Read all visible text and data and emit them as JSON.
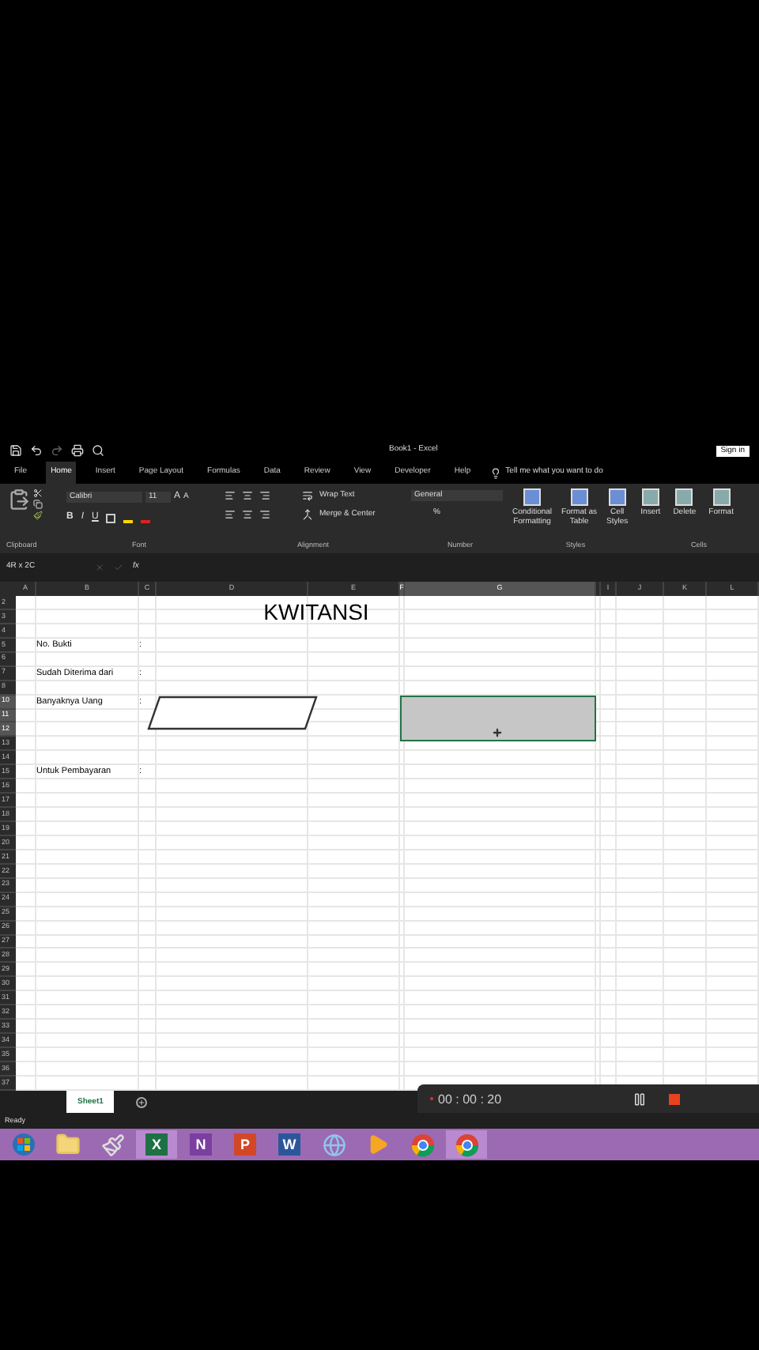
{
  "window": {
    "title": "Book1 - Excel",
    "sign_in": "Sign in"
  },
  "ribbon_tabs": [
    {
      "label": "File",
      "selected": false
    },
    {
      "label": "Home",
      "selected": true
    },
    {
      "label": "Insert",
      "selected": false
    },
    {
      "label": "Page Layout",
      "selected": false
    },
    {
      "label": "Formulas",
      "selected": false
    },
    {
      "label": "Data",
      "selected": false
    },
    {
      "label": "Review",
      "selected": false
    },
    {
      "label": "View",
      "selected": false
    },
    {
      "label": "Developer",
      "selected": false
    },
    {
      "label": "Help",
      "selected": false
    }
  ],
  "tell_me": "Tell me what you want to do",
  "ribbon": {
    "font": "Calibri",
    "size": "11",
    "grow": "A",
    "shrink": "A",
    "styles": [
      "B",
      "I",
      "U"
    ],
    "wrap_text": "Wrap Text",
    "merge": "Merge & Center",
    "number_format": "General",
    "percent": "%",
    "style_buttons": [
      {
        "line1": "Conditional",
        "line2": "Formatting"
      },
      {
        "line1": "Format as",
        "line2": "Table"
      },
      {
        "line1": "Cell",
        "line2": "Styles"
      }
    ],
    "cell_buttons": [
      "Insert",
      "Delete",
      "Format"
    ],
    "groups": [
      "Clipboard",
      "Font",
      "Alignment",
      "Number",
      "Styles",
      "Cells"
    ]
  },
  "name_box": "4R x 2C",
  "fx": "fx",
  "columns": [
    {
      "label": "A",
      "selected": false
    },
    {
      "label": "B",
      "selected": false
    },
    {
      "label": "C",
      "selected": false
    },
    {
      "label": "D",
      "selected": false
    },
    {
      "label": "E",
      "selected": false
    },
    {
      "label": "F",
      "selected": true
    },
    {
      "label": "G",
      "selected": true
    },
    {
      "selected": false
    },
    {
      "label": "I",
      "selected": false
    },
    {
      "label": "J",
      "selected": false
    },
    {
      "label": "K",
      "selected": false
    },
    {
      "label": "L",
      "selected": false
    }
  ],
  "rows": [
    {
      "label": "2",
      "selected": false
    },
    {
      "label": "3",
      "selected": false
    },
    {
      "label": "4",
      "selected": false
    },
    {
      "label": "5",
      "selected": false,
      "cell_b": "No. Bukti",
      "cell_c": ":"
    },
    {
      "label": "6",
      "selected": false
    },
    {
      "label": "7",
      "selected": false,
      "cell_b": "Sudah Diterima dari",
      "cell_c": ":"
    },
    {
      "label": "8",
      "selected": false
    },
    {
      "label": "10",
      "selected": true,
      "cell_b": "Banyaknya Uang",
      "cell_c": ":"
    },
    {
      "label": "11",
      "selected": true
    },
    {
      "label": "12",
      "selected": true
    },
    {
      "label": "13",
      "selected": false
    },
    {
      "label": "14",
      "selected": false
    },
    {
      "label": "15",
      "selected": false,
      "cell_b": "Untuk Pembayaran",
      "cell_c": ":"
    },
    {
      "label": "16",
      "selected": false
    },
    {
      "label": "17",
      "selected": false
    },
    {
      "label": "18",
      "selected": false
    },
    {
      "label": "19",
      "selected": false
    },
    {
      "label": "20",
      "selected": false
    },
    {
      "label": "21",
      "selected": false
    },
    {
      "label": "22",
      "selected": false
    },
    {
      "label": "23",
      "selected": false
    },
    {
      "label": "24",
      "selected": false
    },
    {
      "label": "25",
      "selected": false
    },
    {
      "label": "26",
      "selected": false
    },
    {
      "label": "27",
      "selected": false
    },
    {
      "label": "28",
      "selected": false
    },
    {
      "label": "29",
      "selected": false
    },
    {
      "label": "30",
      "selected": false
    },
    {
      "label": "31",
      "selected": false
    },
    {
      "label": "32",
      "selected": false
    },
    {
      "label": "33",
      "selected": false
    },
    {
      "label": "34",
      "selected": false
    },
    {
      "label": "35",
      "selected": false
    },
    {
      "label": "36",
      "selected": false
    },
    {
      "label": "37",
      "selected": false
    }
  ],
  "sheet_title": "KWITANSI",
  "sheet_tabs": [
    {
      "label": "Sheet1",
      "selected": true
    }
  ],
  "status": "Ready",
  "recorder": {
    "time": "00 : 00 : 20"
  },
  "taskbar": [
    {
      "kind": "start",
      "selected": false
    },
    {
      "kind": "folder",
      "selected": false
    },
    {
      "kind": "paint",
      "selected": false
    },
    {
      "kind": "app",
      "label": "X",
      "color": "#1e7145",
      "selected": true
    },
    {
      "kind": "app",
      "label": "N",
      "color": "#7b3fa0",
      "selected": false
    },
    {
      "kind": "app",
      "label": "P",
      "color": "#d24726",
      "selected": false
    },
    {
      "kind": "app",
      "label": "W",
      "color": "#2b579a",
      "selected": false
    },
    {
      "kind": "globe",
      "selected": false
    },
    {
      "kind": "media",
      "selected": false
    },
    {
      "kind": "chrome",
      "selected": false
    },
    {
      "kind": "chrome",
      "selected": true
    }
  ]
}
